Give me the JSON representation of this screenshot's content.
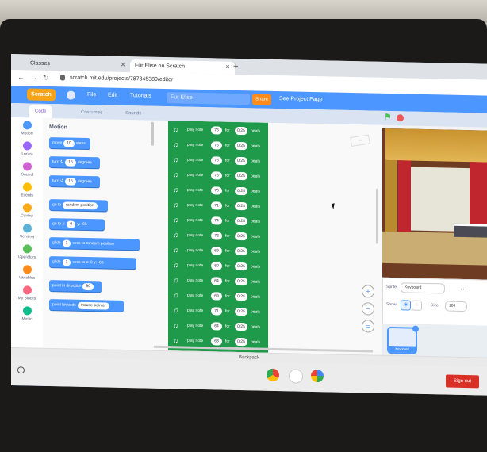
{
  "browser": {
    "tabs": [
      {
        "label": "Classes"
      },
      {
        "label": "Für Elise on Scratch"
      }
    ],
    "url": "scratch.mit.edu/projects/787845389/editor"
  },
  "menubar": {
    "logo": "Scratch",
    "file": "File",
    "edit": "Edit",
    "tutorials": "Tutorials",
    "project_title": "Fur Elise",
    "share": "Share",
    "see_project": "See Project Page"
  },
  "editor_tabs": {
    "code": "Code",
    "costumes": "Costumes",
    "sounds": "Sounds"
  },
  "categories": [
    {
      "label": "Motion",
      "color": "#4c97ff"
    },
    {
      "label": "Looks",
      "color": "#9966ff"
    },
    {
      "label": "Sound",
      "color": "#cf63cf"
    },
    {
      "label": "Events",
      "color": "#ffbf00"
    },
    {
      "label": "Control",
      "color": "#ffab19"
    },
    {
      "label": "Sensing",
      "color": "#5cb1d6"
    },
    {
      "label": "Operators",
      "color": "#59c059"
    },
    {
      "label": "Variables",
      "color": "#ff8c1a"
    },
    {
      "label": "My Blocks",
      "color": "#ff6680"
    },
    {
      "label": "Music",
      "color": "#0fbd8c"
    }
  ],
  "palette": {
    "title": "Motion",
    "blocks": [
      {
        "label": "move",
        "value": "10",
        "suffix": "steps"
      },
      {
        "label": "turn ↻",
        "value": "15",
        "suffix": "degrees"
      },
      {
        "label": "turn ↺",
        "value": "15",
        "suffix": "degrees"
      },
      {
        "label": "go to",
        "value": "random position",
        "suffix": ""
      },
      {
        "label": "go to x:",
        "value": "0",
        "suffix": "y: -65"
      },
      {
        "label": "glide",
        "value": "1",
        "suffix": "secs to random position"
      },
      {
        "label": "glide",
        "value": "1",
        "suffix": "secs to x: 0 y: -65"
      },
      {
        "label": "point in direction",
        "value": "90",
        "suffix": ""
      },
      {
        "label": "point towards",
        "value": "mouse-pointer",
        "suffix": ""
      }
    ]
  },
  "script": {
    "block_label": "play note",
    "for_label": "for",
    "beats_label": "beats",
    "notes": [
      {
        "note": "76",
        "beats": "0.25"
      },
      {
        "note": "75",
        "beats": "0.25"
      },
      {
        "note": "76",
        "beats": "0.25"
      },
      {
        "note": "75",
        "beats": "0.25"
      },
      {
        "note": "76",
        "beats": "0.25"
      },
      {
        "note": "71",
        "beats": "0.25"
      },
      {
        "note": "74",
        "beats": "0.25"
      },
      {
        "note": "72",
        "beats": "0.25"
      },
      {
        "note": "69",
        "beats": "0.25"
      },
      {
        "note": "60",
        "beats": "0.25"
      },
      {
        "note": "64",
        "beats": "0.25"
      },
      {
        "note": "69",
        "beats": "0.25"
      },
      {
        "note": "71",
        "beats": "0.25"
      },
      {
        "note": "64",
        "beats": "0.25"
      },
      {
        "note": "68",
        "beats": "0.25"
      },
      {
        "note": "71",
        "beats": "0.25"
      }
    ]
  },
  "sprite_info": {
    "sprite_label": "Sprite",
    "sprite_name": "Keyboard",
    "show_label": "Show",
    "size_label": "Size",
    "size_value": "100"
  },
  "sprite_list": {
    "selected": "Keyboard"
  },
  "backpack": "Backpack",
  "shelf": {
    "sign_out": "Sign out"
  }
}
